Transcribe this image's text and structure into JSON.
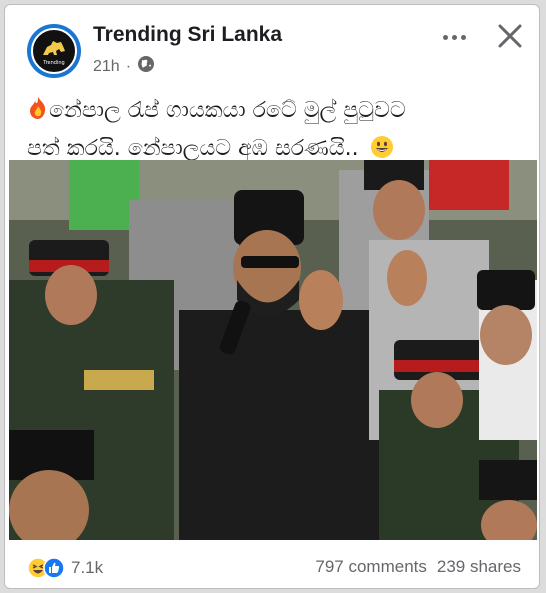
{
  "post": {
    "page_name": "Trending Sri Lanka",
    "time": "21h",
    "separator": "·",
    "audience_icon": "globe-icon",
    "caption_line1": "නේපාල රැප් ගායකයා රටේ මුල් පුටුවට",
    "caption_line2": "පත් කරයි. නේපාලයට අඹ සරණයි..",
    "caption_emojis": [
      "fire-emoji",
      "smile-emoji"
    ]
  },
  "header_actions": {
    "more_icon": "more-options-icon",
    "close_icon": "close-icon"
  },
  "photo": {
    "description_icon": "news-photo"
  },
  "footer": {
    "reaction_icons": [
      "haha-icon",
      "like-icon"
    ],
    "reactions_count": "7.1k",
    "comments": "797 comments",
    "shares": "239 shares"
  },
  "colors": {
    "brand_blue": "#1976d2",
    "text": "#1c1e21",
    "muted": "#65676b"
  }
}
